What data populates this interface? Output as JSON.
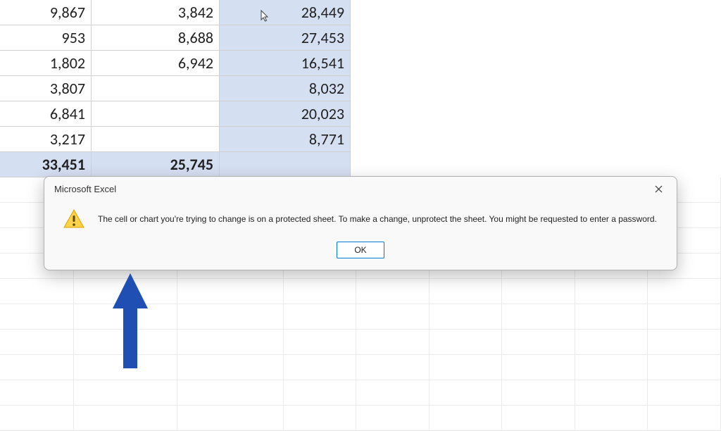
{
  "spreadsheet": {
    "rows": [
      {
        "a": "9,867",
        "b": "3,842",
        "c": "28,449",
        "c_highlight": true,
        "a_highlight": false,
        "bold_row": false
      },
      {
        "a": "953",
        "b": "8,688",
        "c": "27,453",
        "c_highlight": true,
        "a_highlight": false,
        "bold_row": false
      },
      {
        "a": "1,802",
        "b": "6,942",
        "c": "16,541",
        "c_highlight": true,
        "a_highlight": false,
        "bold_row": false
      },
      {
        "a": "3,807",
        "b": "",
        "c": "8,032",
        "c_highlight": true,
        "a_highlight": false,
        "bold_row": false
      },
      {
        "a": "6,841",
        "b": "",
        "c": "20,023",
        "c_highlight": true,
        "a_highlight": false,
        "bold_row": false
      },
      {
        "a": "3,217",
        "b": "",
        "c": "8,771",
        "c_highlight": true,
        "a_highlight": false,
        "bold_row": false
      },
      {
        "a": "33,451",
        "b": "25,745",
        "c": "",
        "c_highlight": true,
        "a_highlight": true,
        "bold_row": true
      }
    ]
  },
  "dialog": {
    "title": "Microsoft Excel",
    "message": "The cell or chart you're trying to change is on a protected sheet. To make a change, unprotect the sheet. You might be requested to enter a password.",
    "ok_label": "OK"
  },
  "colors": {
    "selection": "#d5dff2",
    "arrow": "#1f4fb3"
  }
}
